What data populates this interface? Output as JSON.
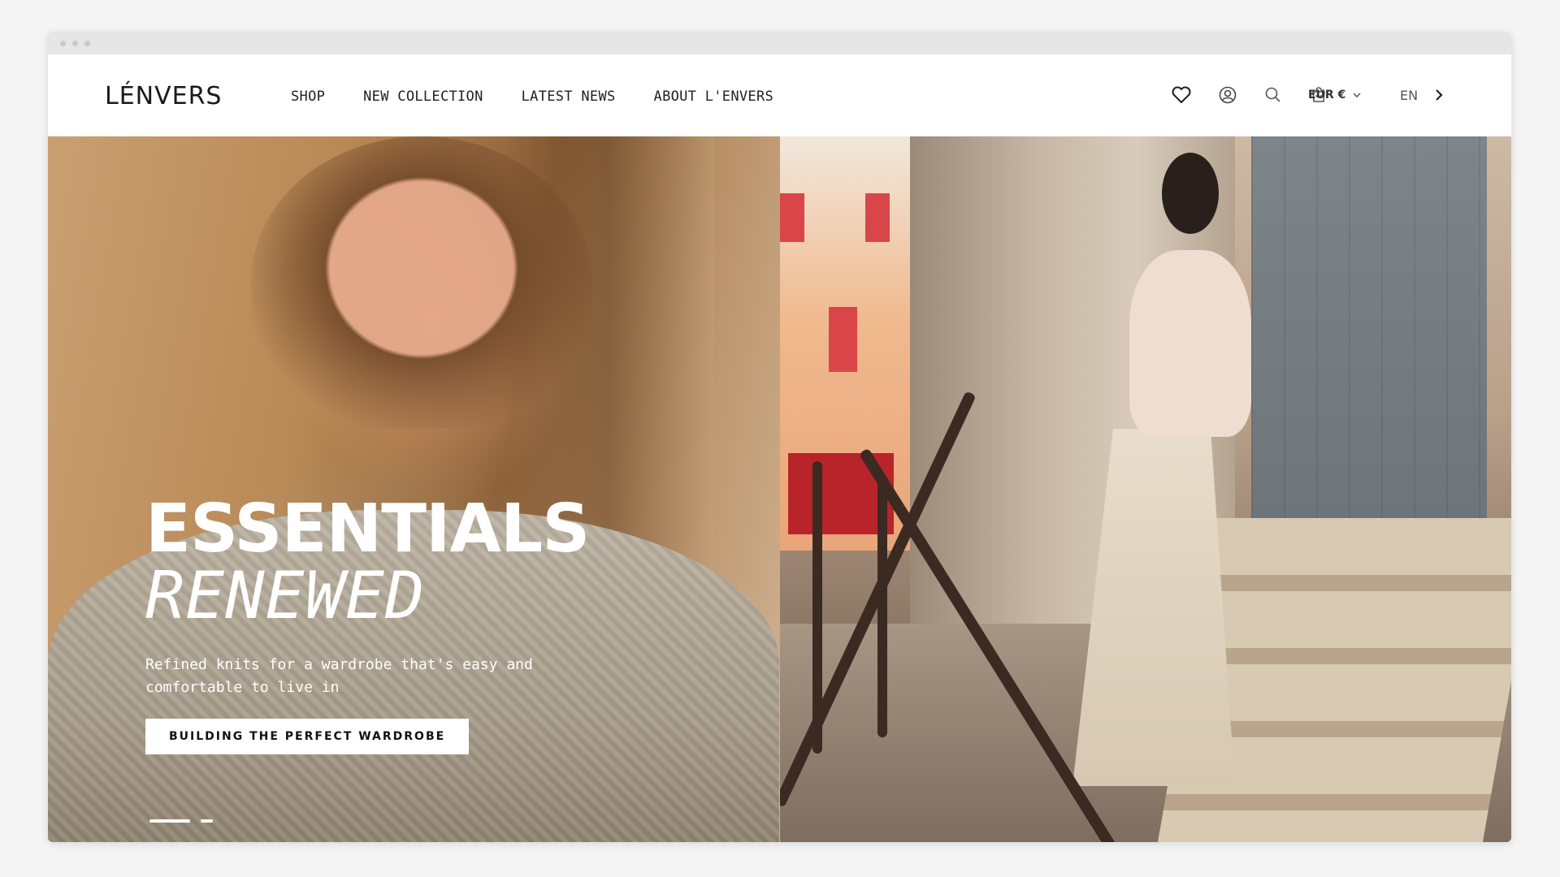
{
  "brand": {
    "logo_text": "LÉNVERS"
  },
  "nav": {
    "items": [
      {
        "label": "SHOP"
      },
      {
        "label": "NEW COLLECTION"
      },
      {
        "label": "LATEST NEWS"
      },
      {
        "label": "ABOUT L'ENVERS"
      }
    ]
  },
  "utilities": {
    "icons": [
      "heart-icon",
      "account-icon",
      "search-icon",
      "bag-icon"
    ],
    "currency": "EUR €",
    "language": "EN"
  },
  "hero": {
    "headline_line1": "ESSENTIALS",
    "headline_line2": "RENEWED",
    "subline": "Refined knits for a wardrobe that's easy and comfortable to live in",
    "cta_label": "BUILDING THE PERFECT WARDROBE",
    "slides_total": 2,
    "active_slide": 1
  },
  "colors": {
    "text_dark": "#1a1a1a",
    "white": "#ffffff"
  }
}
